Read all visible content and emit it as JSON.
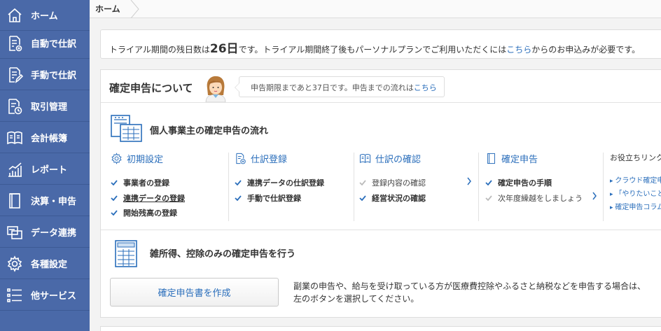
{
  "sidebar": {
    "items": [
      {
        "label": "ホーム",
        "icon": "home-icon"
      },
      {
        "label": "自動で仕訳",
        "icon": "auto-entry-icon"
      },
      {
        "label": "手動で仕訳",
        "icon": "manual-entry-icon"
      },
      {
        "label": "取引管理",
        "icon": "transactions-icon"
      },
      {
        "label": "会計帳簿",
        "icon": "ledger-book-icon"
      },
      {
        "label": "レポート",
        "icon": "report-chart-icon"
      },
      {
        "label": "決算・申告",
        "icon": "settlement-icon"
      },
      {
        "label": "データ連携",
        "icon": "data-link-icon"
      },
      {
        "label": "各種設定",
        "icon": "gear-icon"
      },
      {
        "label": "他サービス",
        "icon": "list-icon"
      }
    ]
  },
  "breadcrumb": {
    "home": "ホーム"
  },
  "trial": {
    "prefix": "トライアル期間の残日数は",
    "days": "26日",
    "middle": "です。トライアル期間終了後もパーソナルプランでご利用いただくには",
    "link": "こちら",
    "suffix": "からのお申込みが必要です。"
  },
  "tax": {
    "title": "確定申告について",
    "bubble_text": "申告期限まであと37日です。申告までの流れは",
    "bubble_link": "こちら",
    "flow_title": "個人事業主の確定申告の流れ",
    "columns": [
      {
        "title": "初期設定",
        "tasks": [
          "事業者の登録",
          "連携データの登録",
          "開始残高の登録"
        ]
      },
      {
        "title": "仕訳登録",
        "tasks": [
          "連携データの仕訳登録",
          "手動で仕訳登録"
        ]
      },
      {
        "title": "仕訳の確認",
        "tasks": [
          "登録内容の確認",
          "経営状況の確認"
        ]
      },
      {
        "title": "確定申告",
        "tasks": [
          "確定申告の手順",
          "次年度繰越をしましょう"
        ]
      }
    ],
    "helpful_title": "お役立ちリンク",
    "helpful_links": [
      "クラウド確定申告",
      "「やりたいこと",
      "確定申告コラム"
    ],
    "misc_title": "雑所得、控除のみの確定申告を行う",
    "create_button": "確定申告書を作成",
    "misc_desc_line1": "副業の申告や、給与を受け取っている方が医療費控除やふるさと納税などを申告する場合は、",
    "misc_desc_line2": "左のボタンを選択してください。"
  },
  "colors": {
    "sidebar": "#4a69a8",
    "accent": "#2a6ebb",
    "check": "#2a6ebb",
    "check_todo": "#bbbbbb"
  }
}
